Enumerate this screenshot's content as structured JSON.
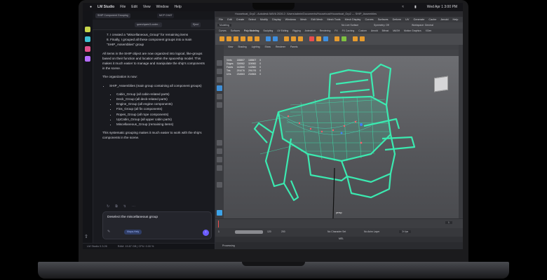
{
  "menubar": {
    "apple": "",
    "app": "LM Studio",
    "items": [
      "File",
      "Edit",
      "View",
      "Window",
      "Help"
    ],
    "clock": "Wed Apr 1  3:00 PM"
  },
  "lm_studio": {
    "tab_chat": "SHIP Component Grouping",
    "tab_other": "MCP CHAT",
    "title_chip": "qwen/qwen3-coder...",
    "eject_label": "Eject",
    "message": {
      "list_items": [
        "7. I created a \"Miscellaneous_Group\" for remaining items",
        "8. Finally, I grouped all these component groups into a main \"SHIP_Assemblies\" group"
      ],
      "para1": "All items in the SHIP object are now organized into logical, like-groups based on their function and location within the spaceship model. This makes it much easier to manage and manipulate the ship's components in the scene.",
      "para2": "The organization is now:",
      "tree_root": "SHIP_Assemblies (main group containing all component groups)",
      "tree_children": [
        "Cabin_Group (all cabin-related parts)",
        "Deck_Group (all deck-related parts)",
        "Engine_Group (all engine components)",
        "Fins_Group (all fin components)",
        "Ropes_Group (all rope components)",
        "UpCabin_Group (all upper cabin parts)",
        "Miscellaneous_Group (remaining items)"
      ],
      "para3": "This systematic grouping makes it much easier to work with the ship's components in the scene."
    },
    "composer_text": "Deselect the miscellaneous group",
    "model_chip": "Maya-Hely",
    "status_left": "LM Studio 0.3.26",
    "status_right": "RAM: 19.87 GB  |  CPU: 0.00 %"
  },
  "maya": {
    "title": "Houseboat_Grp2 - Autodesk MAYA 2026.2: /Users/admin/Documents/Houseboat/Houseboat_Grp2 --- SHIP_Assemblies",
    "menus": [
      "File",
      "Edit",
      "Create",
      "Select",
      "Modify",
      "Display",
      "Windows",
      "Mesh",
      "Edit Mesh",
      "Mesh Tools",
      "Mesh Display",
      "Curves",
      "Surfaces",
      "Deform",
      "UV",
      "Generate",
      "Cache",
      "Arnold",
      "Help"
    ],
    "mode": "Modeling",
    "workspace": "Workspace: General",
    "symmetry": "Symmetry: Off",
    "live": "No Live Surface",
    "shelf_tabs": [
      "Curves",
      "Surfaces",
      "Poly Modeling",
      "Sculpting",
      "UV Editing",
      "Rigging",
      "Animation",
      "Rendering",
      "FX",
      "FX Caching",
      "Custom",
      "Arnold",
      "Bifrost",
      "MASH",
      "Motion Graphics",
      "XGen"
    ],
    "panel_menus": [
      "View",
      "Shading",
      "Lighting",
      "Show",
      "Renderer",
      "Panels"
    ],
    "hud": [
      [
        "Verts",
        "185807",
        "185807",
        "0"
      ],
      [
        "Edges",
        "326982",
        "326982",
        "0"
      ],
      [
        "Faces",
        "142860",
        "142860",
        "0"
      ],
      [
        "Tris",
        "291076",
        "291076",
        "0"
      ],
      [
        "UVs",
        "234563",
        "234563",
        "0"
      ]
    ],
    "camera_label": "persp",
    "frame_start": "1",
    "frame_end": "120",
    "frame_current": "1",
    "anim_end": "200",
    "char_set": "No Character Set",
    "anim_layer": "No Anim Layer",
    "fps": "24 fps",
    "help_line": "Processing",
    "mel_label": "MEL"
  },
  "colors": {
    "wireframe": "#3af2b5",
    "accent": "#6b5cff",
    "maya_bg": "#5e5f63"
  }
}
